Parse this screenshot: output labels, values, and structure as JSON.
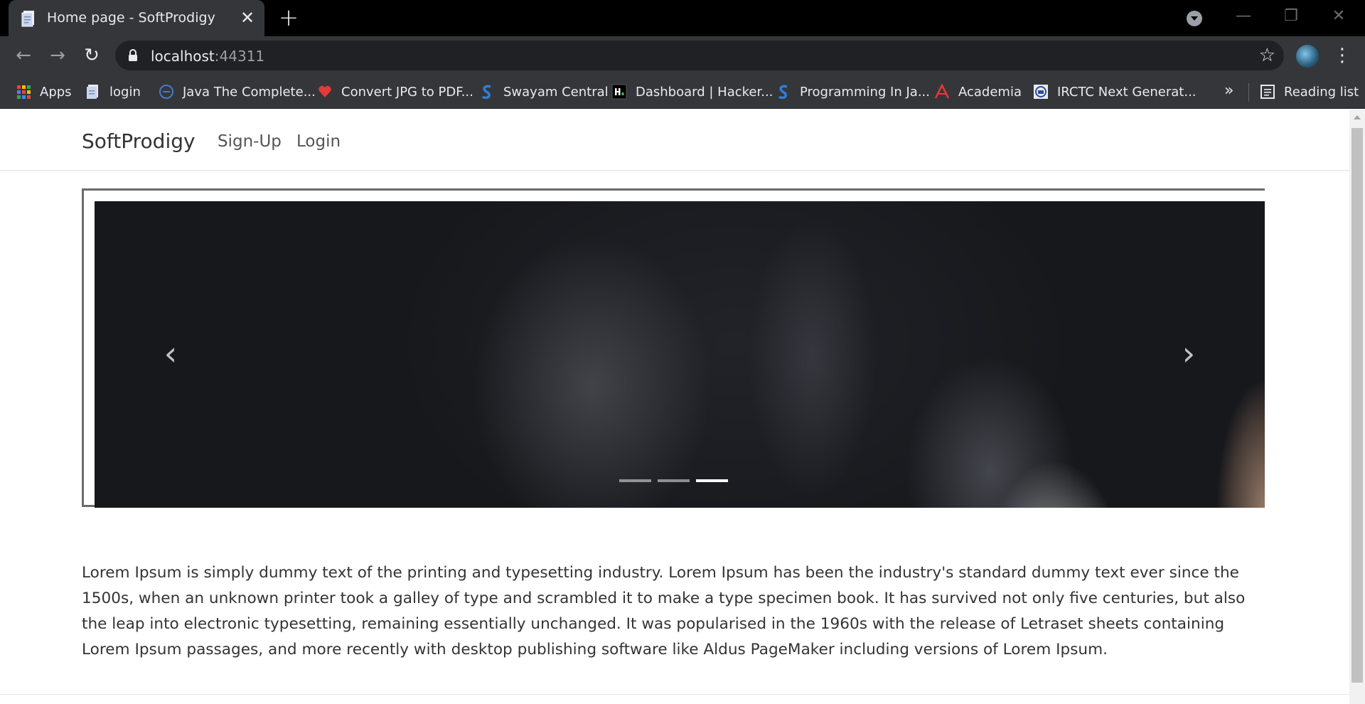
{
  "browser": {
    "tab": {
      "title": "Home page - SoftProdigy",
      "close_glyph": "✕"
    },
    "new_tab_glyph": "+",
    "window_controls": {
      "minimize": "—",
      "restore": "❐",
      "close": "✕"
    },
    "nav": {
      "back": "←",
      "forward": "→",
      "reload": "↻"
    },
    "address": {
      "host": "localhost",
      "port": ":44311"
    },
    "star_glyph": "☆",
    "menu_glyph": "⋮",
    "bookmarks": [
      {
        "label": "Apps",
        "icon": "apps-grid-icon"
      },
      {
        "label": "login",
        "icon": "document-icon"
      },
      {
        "label": "Java The Complete...",
        "icon": "globe-icon"
      },
      {
        "label": "Convert JPG to PDF...",
        "icon": "heart-icon"
      },
      {
        "label": "Swayam Central",
        "icon": "swayam-icon"
      },
      {
        "label": "Dashboard | Hacker...",
        "icon": "hackerrank-icon"
      },
      {
        "label": "Programming In Ja...",
        "icon": "swayam-icon"
      },
      {
        "label": "Academia",
        "icon": "academia-icon"
      },
      {
        "label": "IRCTC Next Generat...",
        "icon": "irctc-icon"
      }
    ],
    "bookmarks_overflow": "»",
    "reading_list": "Reading list"
  },
  "site": {
    "brand": "SoftProdigy",
    "nav_links": [
      "Sign-Up",
      "Login"
    ]
  },
  "carousel": {
    "prev_glyph": "‹",
    "next_glyph": "›",
    "slide_count": 3,
    "active_index": 2
  },
  "content": {
    "paragraph": "Lorem Ipsum is simply dummy text of the printing and typesetting industry. Lorem Ipsum has been the industry's standard dummy text ever since the 1500s, when an unknown printer took a galley of type and scrambled it to make a type specimen book. It has survived not only five centuries, but also the leap into electronic typesetting, remaining essentially unchanged. It was popularised in the 1960s with the release of Letraset sheets containing Lorem Ipsum passages, and more recently with desktop publishing software like Aldus PageMaker including versions of Lorem Ipsum."
  },
  "colors": {
    "chrome_dark": "#35363a",
    "titlebar": "#000000",
    "omnibox": "#202124",
    "text_light": "#e8eaed",
    "page_text": "#333333"
  }
}
